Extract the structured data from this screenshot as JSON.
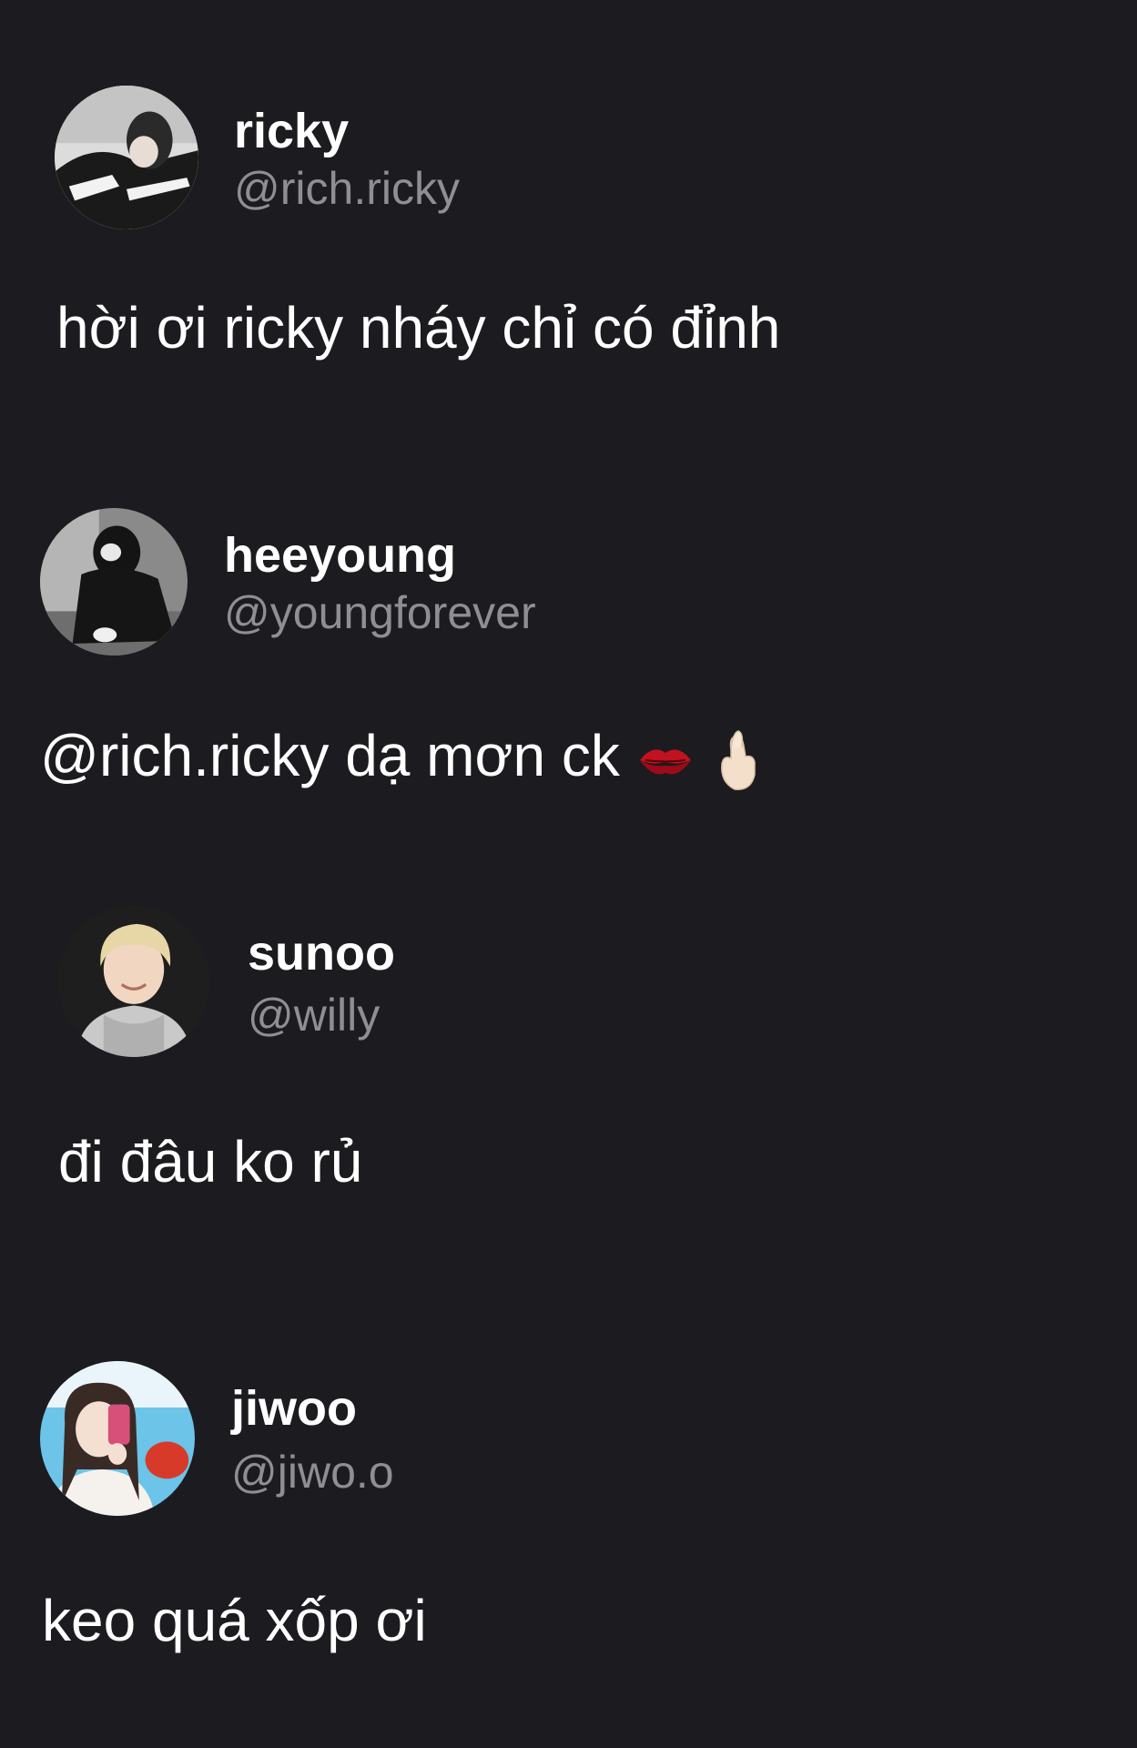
{
  "posts": [
    {
      "display_name": "ricky",
      "handle": "@rich.ricky",
      "text": "hời ơi ricky nháy chỉ có đỉnh",
      "avatar_icon": "avatar-photo-ricky"
    },
    {
      "display_name": "heeyoung",
      "handle": "@youngforever",
      "text": "@rich.ricky dạ mơn ck",
      "avatar_icon": "avatar-photo-heeyoung",
      "emojis": [
        "kiss-mark-icon",
        "finger-heart-icon"
      ]
    },
    {
      "display_name": "sunoo",
      "handle": "@willy",
      "text": "đi đâu ko rủ",
      "avatar_icon": "avatar-photo-sunoo"
    },
    {
      "display_name": "jiwoo",
      "handle": "@jiwo.o",
      "text": "keo quá xốp ơi",
      "avatar_icon": "avatar-photo-jiwoo"
    }
  ],
  "colors": {
    "background": "#1c1b20",
    "name": "#ffffff",
    "handle": "#8e8e93",
    "text": "#ffffff"
  }
}
